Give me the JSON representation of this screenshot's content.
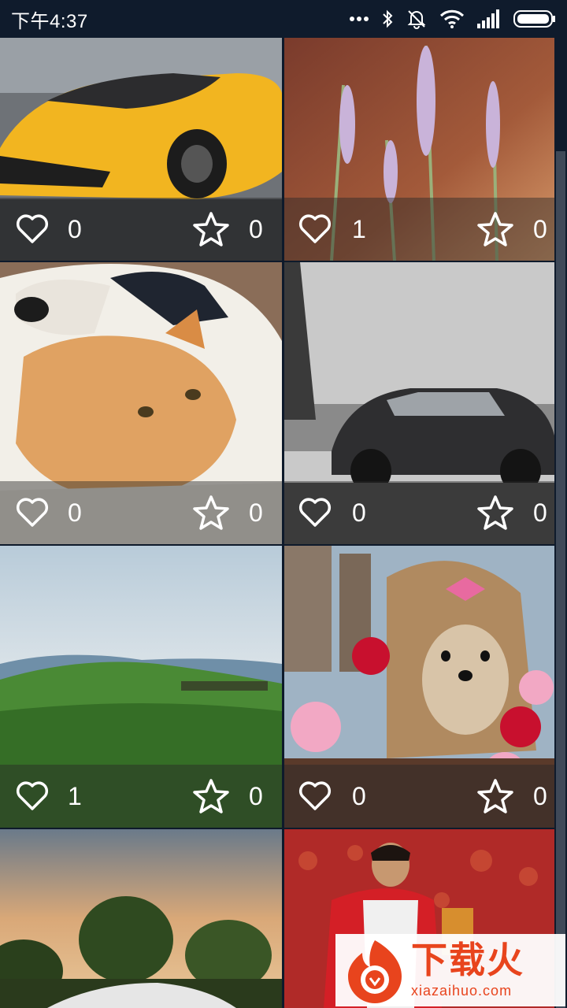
{
  "status_bar": {
    "time": "下午4:37",
    "icons": [
      "more-dots-icon",
      "bluetooth-icon",
      "mute-icon",
      "wifi-icon",
      "signal-icon",
      "battery-icon"
    ]
  },
  "cards": [
    {
      "subject": "yellow sports car",
      "likes": "0",
      "favorites": "0"
    },
    {
      "subject": "lavender flowers",
      "likes": "1",
      "favorites": "0"
    },
    {
      "subject": "dog and cat",
      "likes": "0",
      "favorites": "0"
    },
    {
      "subject": "car near Eiffel tower",
      "likes": "0",
      "favorites": "0"
    },
    {
      "subject": "green hills landscape",
      "likes": "1",
      "favorites": "0"
    },
    {
      "subject": "yorkshire terrier with roses",
      "likes": "0",
      "favorites": "0"
    },
    {
      "subject": "trees at sunset",
      "likes": "",
      "favorites": ""
    },
    {
      "subject": "football player",
      "likes": "",
      "favorites": ""
    }
  ],
  "watermark": {
    "name": "下载火",
    "url": "xiazaihuo.com"
  },
  "colors": {
    "status_bar_bg": "#0f1b2c",
    "overlay_text": "#ffffff",
    "watermark_accent": "#e8441d"
  }
}
